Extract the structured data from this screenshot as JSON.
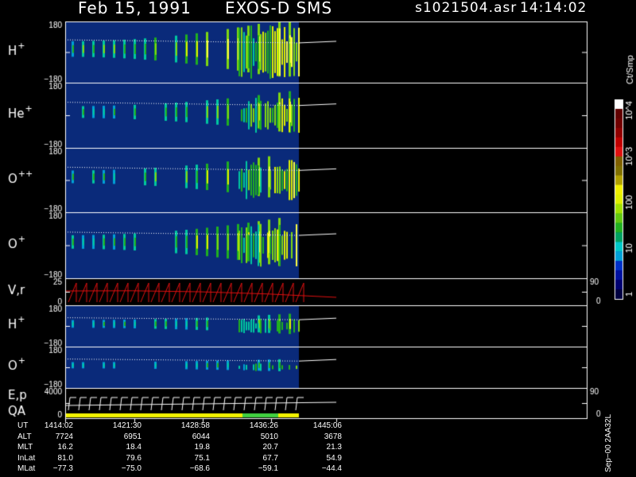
{
  "header": {
    "date": "Feb 15, 1991",
    "instrument": "EXOS-D SMS",
    "file": "s1021504.asr",
    "time": "14:14:02"
  },
  "colors": {
    "background": "#000000",
    "spectrogram_bg": "#0a2a7a",
    "trace": "#ffffff",
    "velocity_trace": "#e01010",
    "qa_yellow": "#f2f200",
    "qa_green": "#40d040"
  },
  "colorbar": {
    "title": "Ct/Smp",
    "tick_labels": [
      "1",
      "10",
      "100",
      "10^3",
      "10^4"
    ],
    "colors": [
      "#000040",
      "#000070",
      "#0010a0",
      "#0030c8",
      "#00a0d8",
      "#00c8c8",
      "#00a060",
      "#20b020",
      "#60c810",
      "#a0e000",
      "#e0f000",
      "#f0f000",
      "#b0a000",
      "#807000",
      "#806000",
      "#e01010",
      "#c00000",
      "#900000",
      "#700000",
      "#600000",
      "#ffffff"
    ]
  },
  "chart_data": {
    "type": "heatmap",
    "x_axis": {
      "label": "UT",
      "ticks": [
        "1414:02",
        "1421:30",
        "1428:58",
        "1436:26",
        "1445:06"
      ],
      "data_end_index": 3.9
    },
    "panels": [
      {
        "species": "H",
        "charge": "+",
        "ymin": "−180",
        "ymax": "180",
        "intensity": 1.0
      },
      {
        "species": "He",
        "charge": "+",
        "ymin": "−180",
        "ymax": "180",
        "intensity": 0.6
      },
      {
        "species": "O",
        "charge": "++",
        "ymin": "−180",
        "ymax": "180",
        "intensity": 0.7
      },
      {
        "species": "O",
        "charge": "+",
        "ymin": "−180",
        "ymax": "180",
        "intensity": 0.75
      },
      {
        "species": "V,r",
        "charge": "",
        "ymin": "0",
        "ymax": "25",
        "right_min": "0",
        "right_max": "90"
      },
      {
        "species": "H",
        "charge": "+",
        "ymin": "−180",
        "ymax": "180",
        "intensity": 0.4
      },
      {
        "species": "O",
        "charge": "+",
        "ymin": "−180",
        "ymax": "180",
        "intensity": 0.2
      },
      {
        "species": "E,p",
        "species2": "QA",
        "charge": "",
        "ymin": "0",
        "ymax": "4000",
        "right_min": "0",
        "right_max": "90"
      }
    ],
    "ephemeris": [
      {
        "name": "UT",
        "values": [
          "1414:02",
          "1421:30",
          "1428:58",
          "1436:26",
          "1445:06"
        ]
      },
      {
        "name": "ALT",
        "values": [
          "7724",
          "6951",
          "6044",
          "5010",
          "3678"
        ]
      },
      {
        "name": "MLT",
        "values": [
          "16.2",
          "18.4",
          "19.8",
          "20.7",
          "21.3"
        ]
      },
      {
        "name": "InLat",
        "values": [
          "81.0",
          "79.6",
          "75.1",
          "67.7",
          "54.9"
        ]
      },
      {
        "name": "MLat",
        "values": [
          "−77.3",
          "−75.0",
          "−68.6",
          "−59.1",
          "−44.4"
        ]
      }
    ]
  },
  "footer_note": "Sep−00 2AA32L"
}
